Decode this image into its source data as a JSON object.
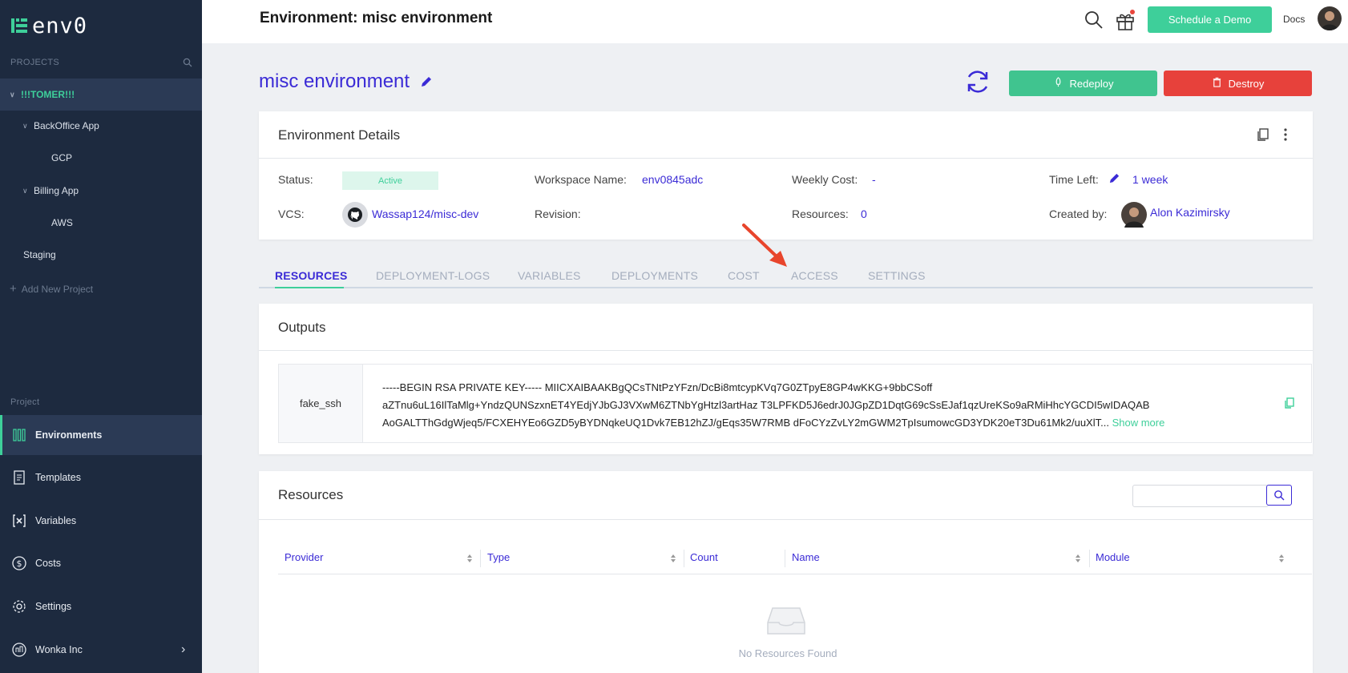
{
  "brand": {
    "logo_text": "env0",
    "accent": "#3ecf9a",
    "primary": "#3b2bd6",
    "danger": "#e7413b"
  },
  "sidebar": {
    "projects_label": "PROJECTS",
    "tree": [
      {
        "label": "!!!TOMER!!!",
        "level": 0,
        "expanded": true,
        "active": true
      },
      {
        "label": "BackOffice App",
        "level": 1,
        "expanded": true
      },
      {
        "label": "GCP",
        "level": 2
      },
      {
        "label": "Billing App",
        "level": 1,
        "expanded": true
      },
      {
        "label": "AWS",
        "level": 2
      },
      {
        "label": "Staging",
        "level": 0
      }
    ],
    "add_project": "Add New Project",
    "project_section_label": "Project",
    "nav": [
      {
        "label": "Environments",
        "icon": "environments-icon",
        "active": true
      },
      {
        "label": "Templates",
        "icon": "templates-icon"
      },
      {
        "label": "Variables",
        "icon": "variables-icon"
      },
      {
        "label": "Costs",
        "icon": "costs-icon"
      },
      {
        "label": "Settings",
        "icon": "settings-icon"
      }
    ],
    "org": {
      "label": "Wonka Inc"
    }
  },
  "header": {
    "title": "Environment: misc environment",
    "demo_button": "Schedule a Demo",
    "docs": "Docs"
  },
  "environment": {
    "name": "misc environment",
    "redeploy": "Redeploy",
    "destroy": "Destroy"
  },
  "details": {
    "title": "Environment Details",
    "status_label": "Status:",
    "status_value": "Active",
    "workspace_label": "Workspace Name:",
    "workspace_value": "env0845adc",
    "weekly_cost_label": "Weekly Cost:",
    "weekly_cost_value": "-",
    "time_left_label": "Time Left:",
    "time_left_value": "1 week",
    "vcs_label": "VCS:",
    "vcs_value": "Wassap124/misc-dev",
    "revision_label": "Revision:",
    "resources_label": "Resources:",
    "resources_value": "0",
    "created_by_label": "Created by:",
    "created_by_value": "Alon Kazimirsky"
  },
  "tabs": [
    "RESOURCES",
    "DEPLOYMENT-LOGS",
    "VARIABLES",
    "DEPLOYMENTS",
    "COST",
    "ACCESS",
    "SETTINGS"
  ],
  "active_tab": "RESOURCES",
  "outputs": {
    "title": "Outputs",
    "key": "fake_ssh",
    "value_line1": "-----BEGIN RSA PRIVATE KEY----- MIICXAIBAAKBgQCsTNtPzYFzn/DcBi8mtcypKVq7G0ZTpyE8GP4wKKG+9bbCSoff",
    "value_line2": "aZTnu6uL16IlTaMlg+YndzQUNSzxnET4YEdjYJbGJ3VXwM6ZTNbYgHtzl3artHaz T3LPFKD5J6edrJ0JGpZD1DqtG69cSsEJaf1qzUreKSo9aRMiHhcYGCDI5wIDAQAB",
    "value_line3": "AoGALTThGdgWjeq5/FCXEHYEo6GZD5yBYDNqkeUQ1Dvk7EB12hZJ/gEqs35W7RMB dFoCYzZvLY2mGWM2TpIsumowcGD3YDK20eT3Du61Mk2/uuXlT...",
    "show_more": "Show more"
  },
  "resources": {
    "title": "Resources",
    "columns": [
      "Provider",
      "Type",
      "Count",
      "Name",
      "Module"
    ],
    "empty_text": "No Resources Found"
  }
}
